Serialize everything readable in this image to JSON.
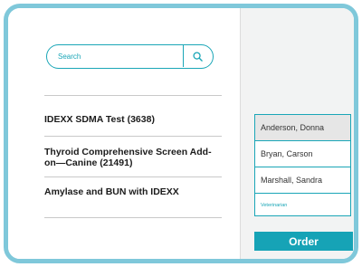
{
  "search": {
    "placeholder": "Search",
    "button_icon": "magnifier-icon"
  },
  "tests": [
    {
      "label": "IDEXX SDMA Test (3638)"
    },
    {
      "label": "Thyroid Comprehensive Screen Add-on—Canine (21491)"
    },
    {
      "label": "Amylase and BUN with IDEXX"
    }
  ],
  "veterinarians": {
    "items": [
      {
        "label": "Anderson, Donna",
        "selected": true
      },
      {
        "label": "Bryan, Carson",
        "selected": false
      },
      {
        "label": "Marshall, Sandra",
        "selected": false
      }
    ],
    "field_label": "Veterinarian"
  },
  "order_button": {
    "label": "Order"
  },
  "colors": {
    "accent": "#16a3b6",
    "frame": "#7fc8da",
    "right_pane_bg": "#f2f3f3",
    "selected_bg": "#e6e6e6"
  }
}
